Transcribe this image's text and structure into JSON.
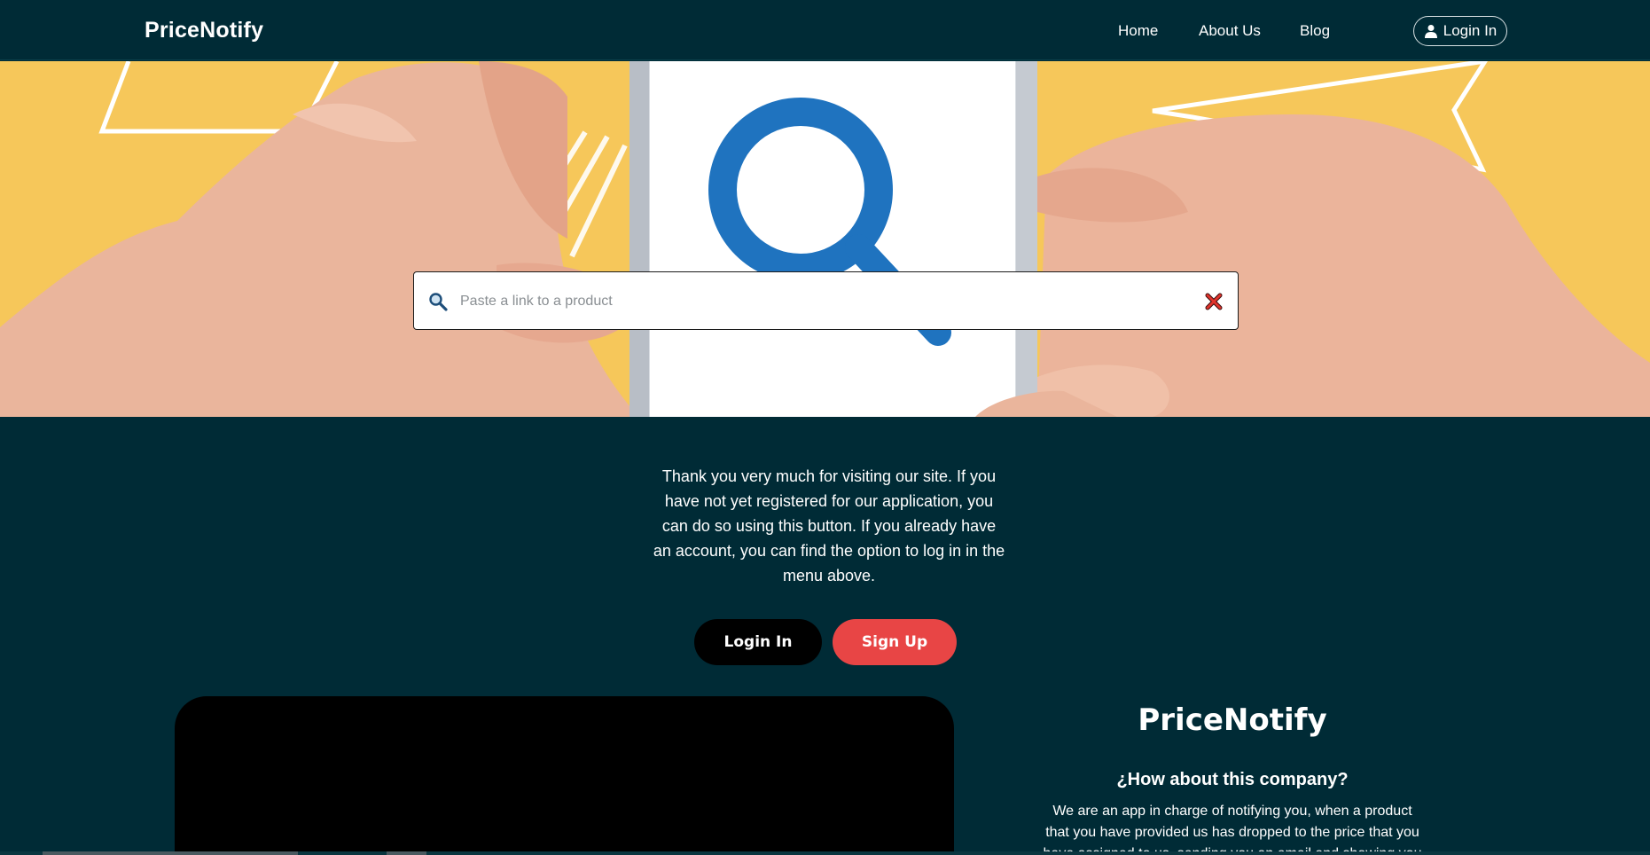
{
  "navbar": {
    "brand": "PriceNotify",
    "links": [
      {
        "label": "Home"
      },
      {
        "label": "About Us"
      },
      {
        "label": "Blog"
      }
    ],
    "login_label": "Login In"
  },
  "hero": {
    "search_placeholder": "Paste a link to a product",
    "search_value": ""
  },
  "intro": {
    "text": "Thank you very much for visiting our site. If you have not yet registered for our application, you can do so using this button. If you already have an account, you can find the option to log in in the menu above.",
    "login_button": "Login In",
    "signup_button": "Sign Up"
  },
  "about": {
    "title": "PriceNotify",
    "subtitle": "¿How about this company?",
    "text": "We are an app in charge of notifying you, when a product that you have provided us has dropped to the price that you have assigned to us, sending you an email and showing you"
  },
  "colors": {
    "background": "#002b36",
    "hero_yellow": "#f6c75a",
    "signup_red": "#e84545",
    "magnifier_blue": "#1f73bf"
  },
  "icons": {
    "user": "user-icon",
    "search": "search-icon",
    "clear": "close-icon"
  }
}
